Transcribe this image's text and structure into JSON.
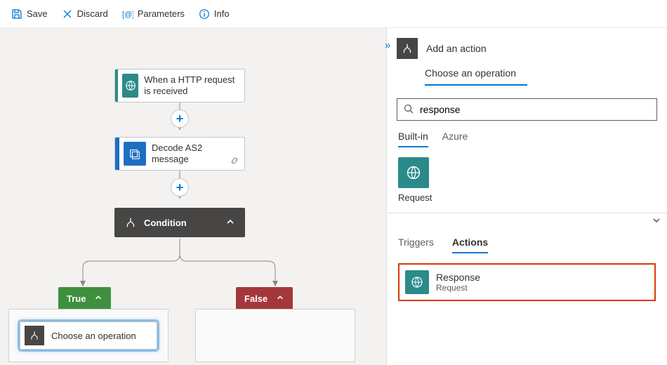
{
  "toolbar": {
    "save": "Save",
    "discard": "Discard",
    "parameters": "Parameters",
    "info": "Info"
  },
  "designer": {
    "http_trigger": "When a HTTP request is received",
    "decode_as2": "Decode AS2 message",
    "condition": "Condition",
    "true_label": "True",
    "false_label": "False",
    "choose_op": "Choose an operation"
  },
  "panel": {
    "title": "Add an action",
    "subtitle": "Choose an operation",
    "search_value": "response",
    "tab_builtin": "Built-in",
    "tab_azure": "Azure",
    "request_label": "Request",
    "subtab_triggers": "Triggers",
    "subtab_actions": "Actions",
    "item_title": "Response",
    "item_subtitle": "Request"
  }
}
